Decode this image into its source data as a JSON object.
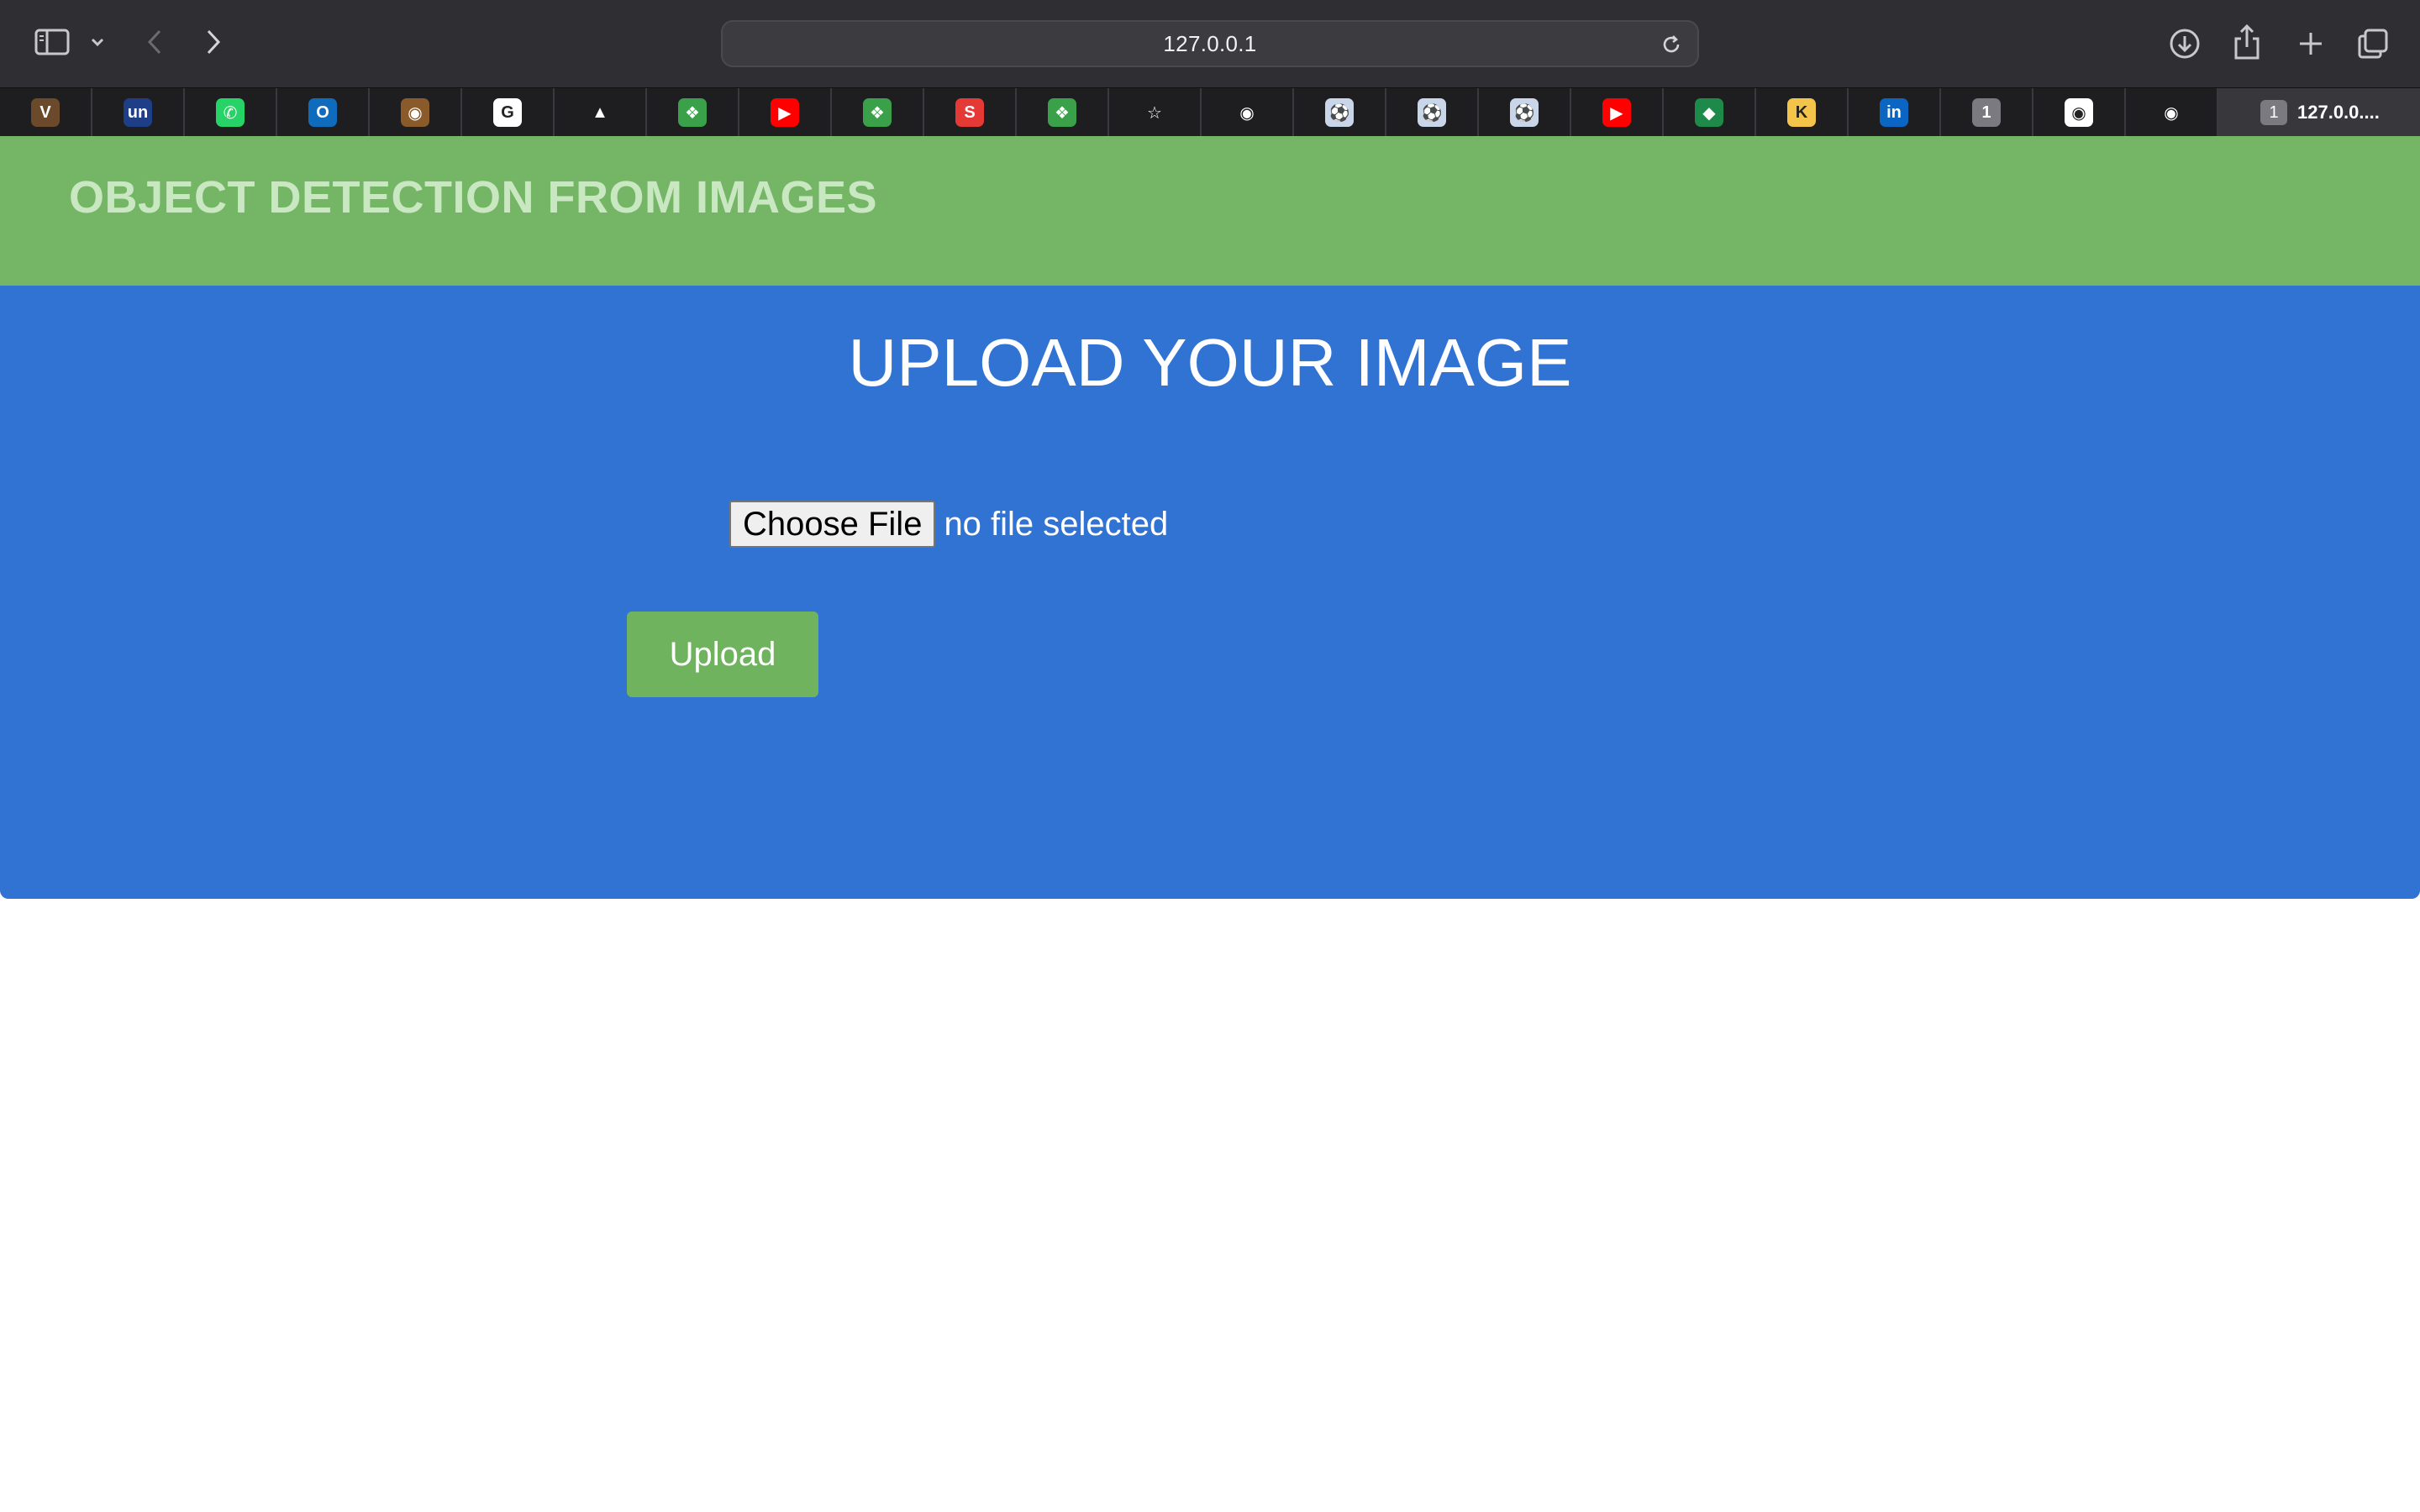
{
  "browser": {
    "url": "127.0.0.1",
    "active_tab": {
      "number": "1",
      "title": "127.0.0...."
    },
    "icons": {
      "sidebar": "sidebar-icon",
      "tab_group_menu": "chevron-down-icon",
      "back": "chevron-left-icon",
      "forward": "chevron-right-icon",
      "reload": "reload-icon",
      "downloads": "download-icon",
      "share": "share-icon",
      "new_tab": "plus-icon",
      "tab_overview": "tab-overview-icon"
    },
    "favorites": [
      {
        "name": "vision-boost",
        "glyph": "V",
        "bg": "#6b4a2c"
      },
      {
        "name": "unstop",
        "glyph": "un",
        "bg": "#1e3e88"
      },
      {
        "name": "whatsapp",
        "glyph": "✆",
        "bg": "#25d366"
      },
      {
        "name": "outlook",
        "glyph": "O",
        "bg": "#0f6cbd"
      },
      {
        "name": "monkey",
        "glyph": "◉",
        "bg": "#8a5a2b"
      },
      {
        "name": "google",
        "glyph": "G",
        "bg": "#ffffff"
      },
      {
        "name": "google-drive",
        "glyph": "▲",
        "bg": "#1e1e21"
      },
      {
        "name": "green-app-1",
        "glyph": "❖",
        "bg": "#3aa14a"
      },
      {
        "name": "youtube-1",
        "glyph": "▶",
        "bg": "#ff0000"
      },
      {
        "name": "green-app-2",
        "glyph": "❖",
        "bg": "#3aa14a"
      },
      {
        "name": "red-app",
        "glyph": "S",
        "bg": "#e53935"
      },
      {
        "name": "green-app-3",
        "glyph": "❖",
        "bg": "#3aa14a"
      },
      {
        "name": "bookmark-star",
        "glyph": "☆",
        "bg": "#1e1e21"
      },
      {
        "name": "github-1",
        "glyph": "◉",
        "bg": "#1e1e21"
      },
      {
        "name": "soccer-1",
        "glyph": "⚽",
        "bg": "#c9d6ea"
      },
      {
        "name": "soccer-2",
        "glyph": "⚽",
        "bg": "#c9d6ea"
      },
      {
        "name": "soccer-3",
        "glyph": "⚽",
        "bg": "#c9d6ea"
      },
      {
        "name": "youtube-2",
        "glyph": "▶",
        "bg": "#ff0000"
      },
      {
        "name": "shield-app",
        "glyph": "◆",
        "bg": "#1e8a4a"
      },
      {
        "name": "k-app",
        "glyph": "K",
        "bg": "#f3c34a"
      },
      {
        "name": "linkedin",
        "glyph": "in",
        "bg": "#0a66c2"
      },
      {
        "name": "numbered-tab",
        "glyph": "1",
        "bg": "#7a7a80"
      },
      {
        "name": "github-2",
        "glyph": "◉",
        "bg": "#ffffff"
      },
      {
        "name": "github-3",
        "glyph": "◉",
        "bg": "#1e1e21"
      }
    ]
  },
  "page": {
    "site_title": "OBJECT DETECTION FROM IMAGES",
    "heading": "UPLOAD YOUR IMAGE",
    "file_input": {
      "button_label": "Choose File",
      "status": "no file selected"
    },
    "upload_button": "Upload"
  },
  "colors": {
    "header_bg": "#74b666",
    "header_text": "#c9e8c2",
    "panel_bg": "#3173d3",
    "upload_button_bg": "#6fb35f"
  }
}
